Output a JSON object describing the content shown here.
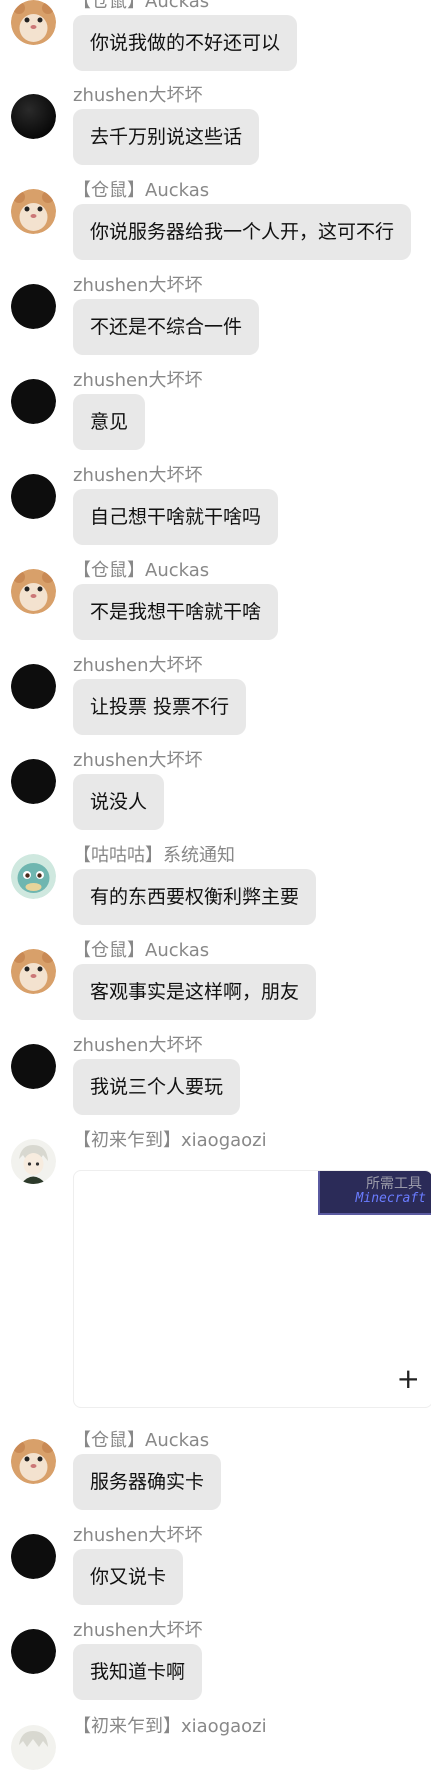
{
  "messages": [
    {
      "avatar": "hamster-avatar",
      "tag": "【仓鼠】",
      "name": "Auckas",
      "text": "你说我做的不好还可以"
    },
    {
      "avatar": "black-avatar",
      "tag": "",
      "name": "zhushen大坏坏",
      "text": "去千万别说这些话"
    },
    {
      "avatar": "hamster-avatar",
      "tag": "【仓鼠】",
      "name": "Auckas",
      "text": "你说服务器给我一个人开，这可不行"
    },
    {
      "avatar": "black-avatar",
      "tag": "",
      "name": "zhushen大坏坏",
      "text": "不还是不综合一件"
    },
    {
      "avatar": "black-avatar",
      "tag": "",
      "name": "zhushen大坏坏",
      "text": "意见"
    },
    {
      "avatar": "black-avatar",
      "tag": "",
      "name": "zhushen大坏坏",
      "text": "自己想干啥就干啥吗"
    },
    {
      "avatar": "hamster-avatar",
      "tag": "【仓鼠】",
      "name": "Auckas",
      "text": "不是我想干啥就干啥"
    },
    {
      "avatar": "black-avatar",
      "tag": "",
      "name": "zhushen大坏坏",
      "text": "让投票 投票不行"
    },
    {
      "avatar": "black-avatar",
      "tag": "",
      "name": "zhushen大坏坏",
      "text": "说没人"
    },
    {
      "avatar": "squirtle-avatar",
      "tag": "【咕咕咕】",
      "name": "系统通知",
      "text": "有的东西要权衡利弊主要"
    },
    {
      "avatar": "hamster-avatar",
      "tag": "【仓鼠】",
      "name": "Auckas",
      "text": "客观事实是这样啊，朋友"
    },
    {
      "avatar": "black-avatar",
      "tag": "",
      "name": "zhushen大坏坏",
      "text": "我说三个人要玩"
    },
    {
      "avatar": "anime-avatar",
      "tag": "【初来乍到】",
      "name": "xiaogaozi",
      "text": ""
    },
    {
      "avatar": "hamster-avatar",
      "tag": "【仓鼠】",
      "name": "Auckas",
      "text": "服务器确实卡"
    },
    {
      "avatar": "black-avatar",
      "tag": "",
      "name": "zhushen大坏坏",
      "text": "你又说卡"
    },
    {
      "avatar": "black-avatar",
      "tag": "",
      "name": "zhushen大坏坏",
      "text": "我知道卡啊"
    },
    {
      "avatar": "anime-avatar",
      "tag": "【初来乍到】",
      "name": "xiaogaozi",
      "text": ""
    }
  ],
  "image_card": {
    "strip_text": "所需工具",
    "strip_brand": "Minecraft",
    "plus_icon": "+"
  }
}
